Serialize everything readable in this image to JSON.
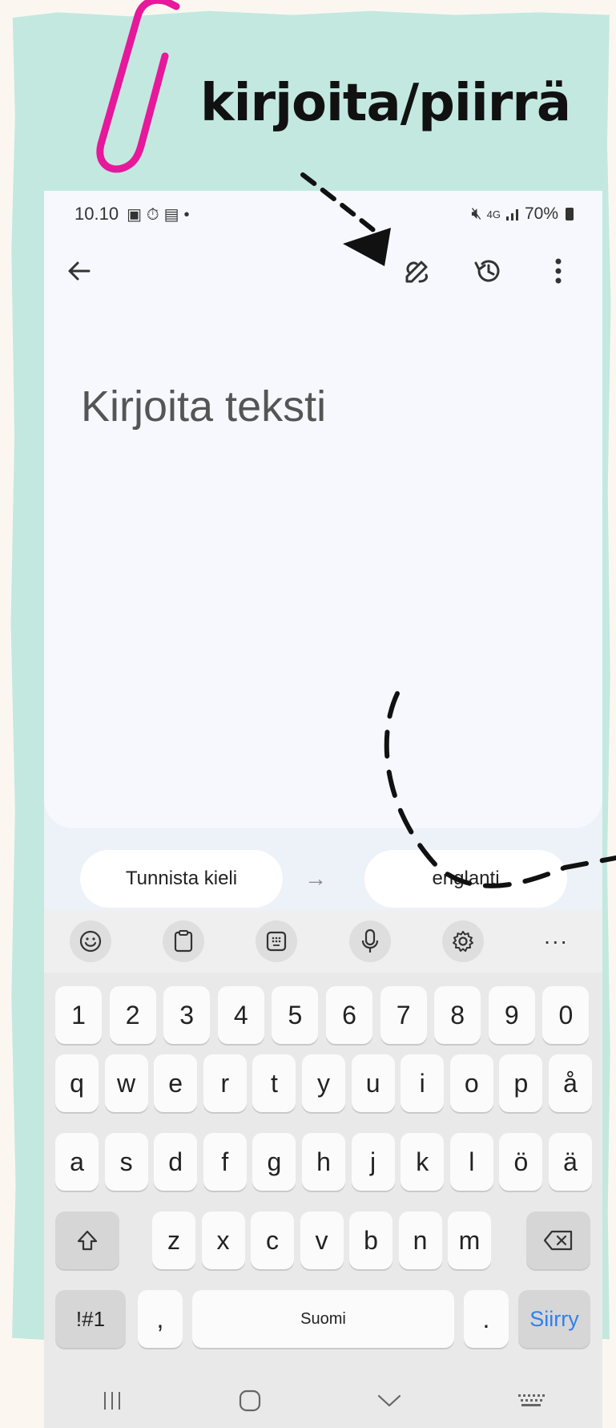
{
  "annotation": {
    "headline": "kirjoita/piirrä",
    "colors": {
      "paper": "#c3e8e0",
      "clip": "#e6189b",
      "arrow": "#111111"
    }
  },
  "status_bar": {
    "time": "10.10",
    "left_icons": [
      "gallery-icon",
      "timer-icon",
      "screen-icon",
      "dot-icon"
    ],
    "network": "4G",
    "battery": "70%"
  },
  "toolbar": {
    "back_icon": "back-arrow-icon",
    "handwrite_icon": "handwrite-icon",
    "history_icon": "history-icon",
    "more_icon": "more-vert-icon"
  },
  "editor": {
    "placeholder": "Kirjoita teksti"
  },
  "languages": {
    "source": "Tunnista kieli",
    "target": "englanti"
  },
  "keyboard": {
    "tool_icons": [
      "emoji-icon",
      "clipboard-icon",
      "keypad-icon",
      "mic-icon",
      "settings-icon"
    ],
    "more_label": "···",
    "number_row": [
      "1",
      "2",
      "3",
      "4",
      "5",
      "6",
      "7",
      "8",
      "9",
      "0"
    ],
    "row1": [
      "q",
      "w",
      "e",
      "r",
      "t",
      "y",
      "u",
      "i",
      "o",
      "p",
      "å"
    ],
    "row2": [
      "a",
      "s",
      "d",
      "f",
      "g",
      "h",
      "j",
      "k",
      "l",
      "ö",
      "ä"
    ],
    "row3": [
      "z",
      "x",
      "c",
      "v",
      "b",
      "n",
      "m"
    ],
    "symbols_label": "!#1",
    "comma_label": ",",
    "space_label": "Suomi",
    "period_label": ".",
    "go_label": "Siirry"
  },
  "nav_icons": [
    "recents-icon",
    "home-icon",
    "back-chevron-icon",
    "keyboard-hide-icon"
  ]
}
